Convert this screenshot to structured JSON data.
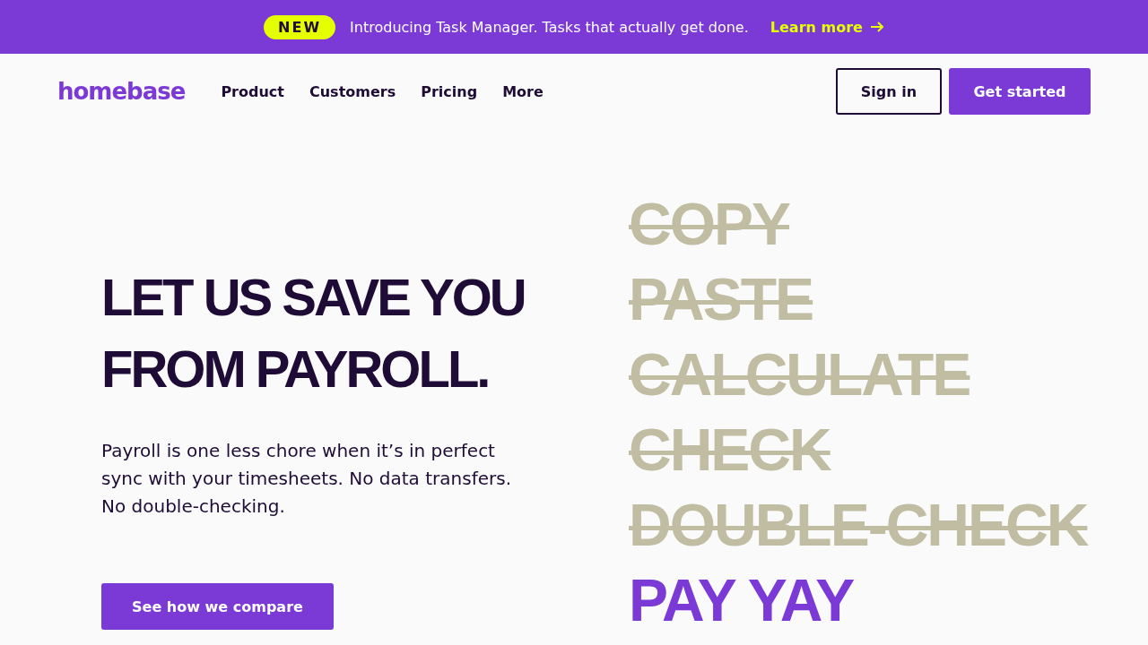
{
  "announcement": {
    "badge": "NEW",
    "text": "Introducing Task Manager. Tasks that actually get done.",
    "link": "Learn more"
  },
  "nav": {
    "logo": "homebase",
    "items": [
      "Product",
      "Customers",
      "Pricing",
      "More"
    ],
    "sign_in": "Sign in",
    "get_started": "Get started"
  },
  "hero": {
    "headline": [
      "LET US SAVE YOU",
      "FROM PAYROLL."
    ],
    "body": "Payroll is one less chore when it’s in perfect sync with your timesheets. No data transfers. No double-checking.",
    "cta": "See how we compare"
  },
  "words": [
    {
      "text": "COPY",
      "struck": true
    },
    {
      "text": "PASTE",
      "struck": true
    },
    {
      "text": "CALCULATE",
      "struck": true
    },
    {
      "text": "CHECK",
      "struck": true
    },
    {
      "text": "DOUBLE-CHECK",
      "struck": true
    },
    {
      "text": "PAY YAY",
      "struck": false
    }
  ]
}
